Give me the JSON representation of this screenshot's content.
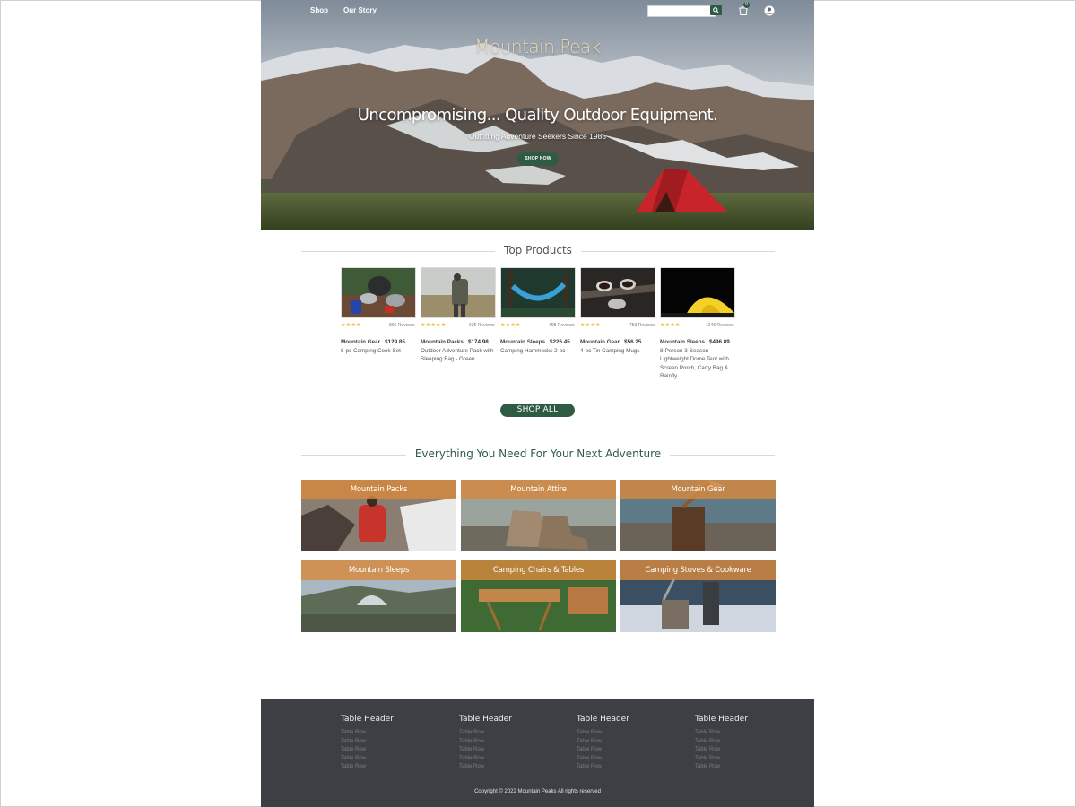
{
  "nav": {
    "shop": "Shop",
    "story": "Our Story",
    "cart_count": "0"
  },
  "search": {
    "placeholder": ""
  },
  "hero": {
    "brand": "Mountain Peak",
    "headline": "Uncompromising... Quality Outdoor Equipment.",
    "subtitle": "Outfitting Adventure Seekers Since 1985",
    "cta": "SHOP NOW"
  },
  "top_products": {
    "heading": "Top Products",
    "items": [
      {
        "rating": 4,
        "reviews": "806 Reviews",
        "brand": "Mountain Gear",
        "price": "$129.85",
        "name": "6-pc Camping Cook Set"
      },
      {
        "rating": 5,
        "reviews": "635 Reviews",
        "brand": "Mountain Packs",
        "price": "$174.98",
        "name": "Outdoor Adventure Pack with Sleeping Bag - Green"
      },
      {
        "rating": 4,
        "reviews": "408 Reviews",
        "brand": "Mountain Sleeps",
        "price": "$226.45",
        "name": "Camping Hammocks 2-pc"
      },
      {
        "rating": 4,
        "reviews": "753 Reviews",
        "brand": "Mountain Gear",
        "price": "$56.25",
        "name": "4-pc Tin Camping Mugs"
      },
      {
        "rating": 4,
        "reviews": "1246 Reviews",
        "brand": "Mountain Sleeps",
        "price": "$496.89",
        "name": "8-Person 3-Season Lightweight Dome Tent with Screen Porch, Carry Bag & Rainfly"
      }
    ],
    "shop_all": "SHOP ALL"
  },
  "adventure": {
    "heading": "Everything You Need For Your Next Adventure",
    "categories": [
      "Mountain Packs",
      "Mountain Attire",
      "Mountain Gear",
      "Mountain Sleeps",
      "Camping Chairs & Tables",
      "Camping Stoves & Cookware"
    ]
  },
  "footer": {
    "columns": [
      {
        "header": "Table Header",
        "rows": [
          "Table Row",
          "Table Row",
          "Table Row",
          "Table Row",
          "Table Row"
        ]
      },
      {
        "header": "Table Header",
        "rows": [
          "Table Row",
          "Table Row",
          "Table Row",
          "Table Row",
          "Table Row"
        ]
      },
      {
        "header": "Table Header",
        "rows": [
          "Table Row",
          "Table Row",
          "Table Row",
          "Table Row",
          "Table Row"
        ]
      },
      {
        "header": "Table Header",
        "rows": [
          "Table Row",
          "Table Row",
          "Table Row",
          "Table Row",
          "Table Row"
        ]
      }
    ],
    "copyright": "Copyright © 2022 Mountain Peaks All rights reserved"
  },
  "colors": {
    "brand_green": "#2f5b45",
    "category_band": "#d5893e",
    "star": "#f0b51d",
    "footer_bg": "#3c3f43"
  },
  "icons": [
    "search-icon",
    "cart-icon",
    "account-icon",
    "star-icon"
  ]
}
